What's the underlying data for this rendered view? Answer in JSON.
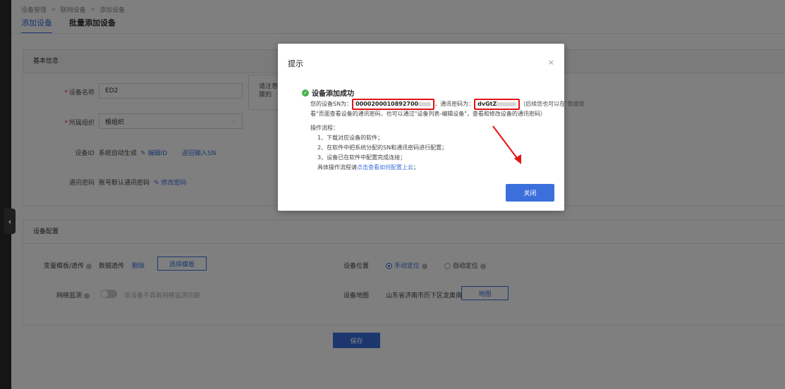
{
  "breadcrumb": [
    "设备管理",
    "联网设备",
    "添加设备"
  ],
  "breadcrumb_sep": ">",
  "tabs": [
    {
      "label": "添加设备",
      "active": true
    },
    {
      "label": "批量添加设备",
      "active": false
    }
  ],
  "basic_info": {
    "title": "基本信息",
    "device_name_label": "设备名称",
    "device_name_value": "ED2",
    "org_label": "所属组织",
    "org_value": "根组织",
    "device_id_label": "设备ID",
    "device_id_value": "系统自动生成",
    "edit_id_link": "编辑ID",
    "back_sn_link": "返回输入SN",
    "password_label": "通讯密码",
    "password_value": "账号默认通讯密码",
    "edit_password_link": "修改密码",
    "notice_text": "请注意步骤的"
  },
  "device_config": {
    "title": "设备配置",
    "var_template_label": "变量模板/透传",
    "var_template_value": "数据透传",
    "delete_link": "删除",
    "choose_template_btn": "选择模板",
    "monitor_label": "网络监测",
    "monitor_hint": "该设备不具有网络监测功能",
    "location_label": "设备位置",
    "manual_location": "手动定位",
    "auto_location": "自动定位",
    "map_label": "设备地图",
    "map_address": "山东省济南市历下区龙奥南路",
    "map_btn": "地图"
  },
  "save_btn": "保存",
  "modal": {
    "title": "提示",
    "close": "×",
    "success_title": "设备添加成功",
    "sn_prefix": "您的设备SN为：",
    "sn_value": "0000200010892700",
    "pwd_prefix": "，通讯密码为：",
    "pwd_value": "dvGtZ",
    "line1_suffix": "（后续您也可以在\"数据查",
    "line2": "看\"页面查看设备的通讯密码，也可以通过\"设备列表-编辑设备\"，查看和修改设备的通讯密码）",
    "process_title": "操作流程：",
    "step1": "1、下载对应设备的软件；",
    "step2": "2、在软件中把系统分配的SN和通讯密码进行配置；",
    "step3": "3、设备已在软件中配置完成连接；",
    "detail_prefix": "具体操作流程请",
    "detail_link": "点击查看如何配置上云",
    "detail_suffix": "；",
    "close_btn": "关闭"
  },
  "colors": {
    "accent": "#3b6fdc",
    "success": "#43b34b",
    "highlight": "#e31414"
  }
}
